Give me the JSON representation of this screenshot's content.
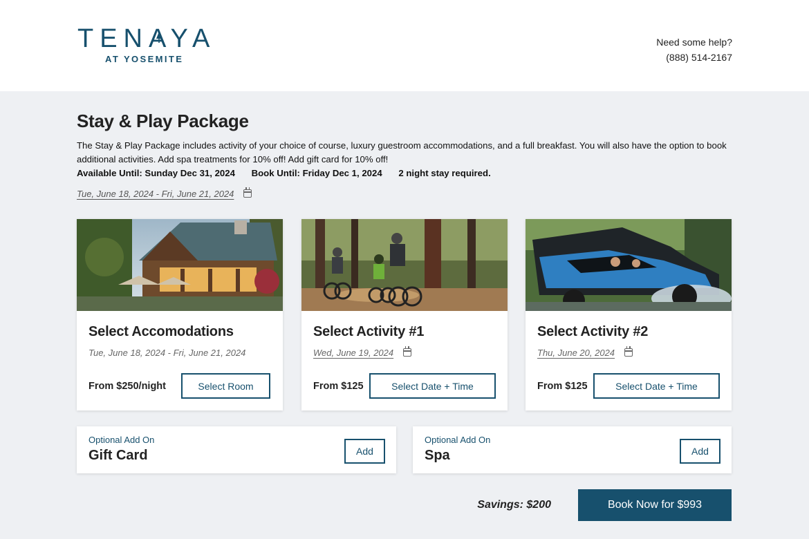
{
  "header": {
    "logo_main": "TENAYA",
    "logo_sub": "AT YOSEMITE",
    "help_text": "Need some help?",
    "phone": "(888) 514-2167"
  },
  "package": {
    "title": "Stay & Play Package",
    "description": "The Stay & Play Package includes activity of your choice of course, luxury guestroom accommodations, and a full breakfast. You will also have the option to book additional activities. Add spa treatments for 10% off! Add gift card for 10% off!",
    "available_until": "Available Until: Sunday Dec 31, 2024",
    "book_until": "Book Until: Friday Dec 1, 2024",
    "stay_required": "2 night stay required.",
    "date_range": "Tue, June 18, 2024 - Fri, June 21, 2024"
  },
  "cards": [
    {
      "title": "Select Accomodations",
      "date": "Tue, June 18, 2024 - Fri, June 21, 2024",
      "price": "From $250/night",
      "button": "Select Room",
      "image": "lodge-photo"
    },
    {
      "title": "Select Activity #1",
      "date": "Wed, June 19, 2024",
      "price": "From $125",
      "button": "Select Date + Time",
      "image": "mountain-bikers-photo"
    },
    {
      "title": "Select Activity #2",
      "date": "Thu, June 20, 2024",
      "price": "From $125",
      "button": "Select Date + Time",
      "image": "off-road-vehicle-photo"
    }
  ],
  "addons": [
    {
      "label": "Optional Add On",
      "name": "Gift Card",
      "button": "Add"
    },
    {
      "label": "Optional Add On",
      "name": "Spa",
      "button": "Add"
    }
  ],
  "footer": {
    "savings": "Savings: $200",
    "book_button": "Book Now for $993"
  },
  "colors": {
    "brand": "#17506d",
    "background": "#eef0f3"
  }
}
